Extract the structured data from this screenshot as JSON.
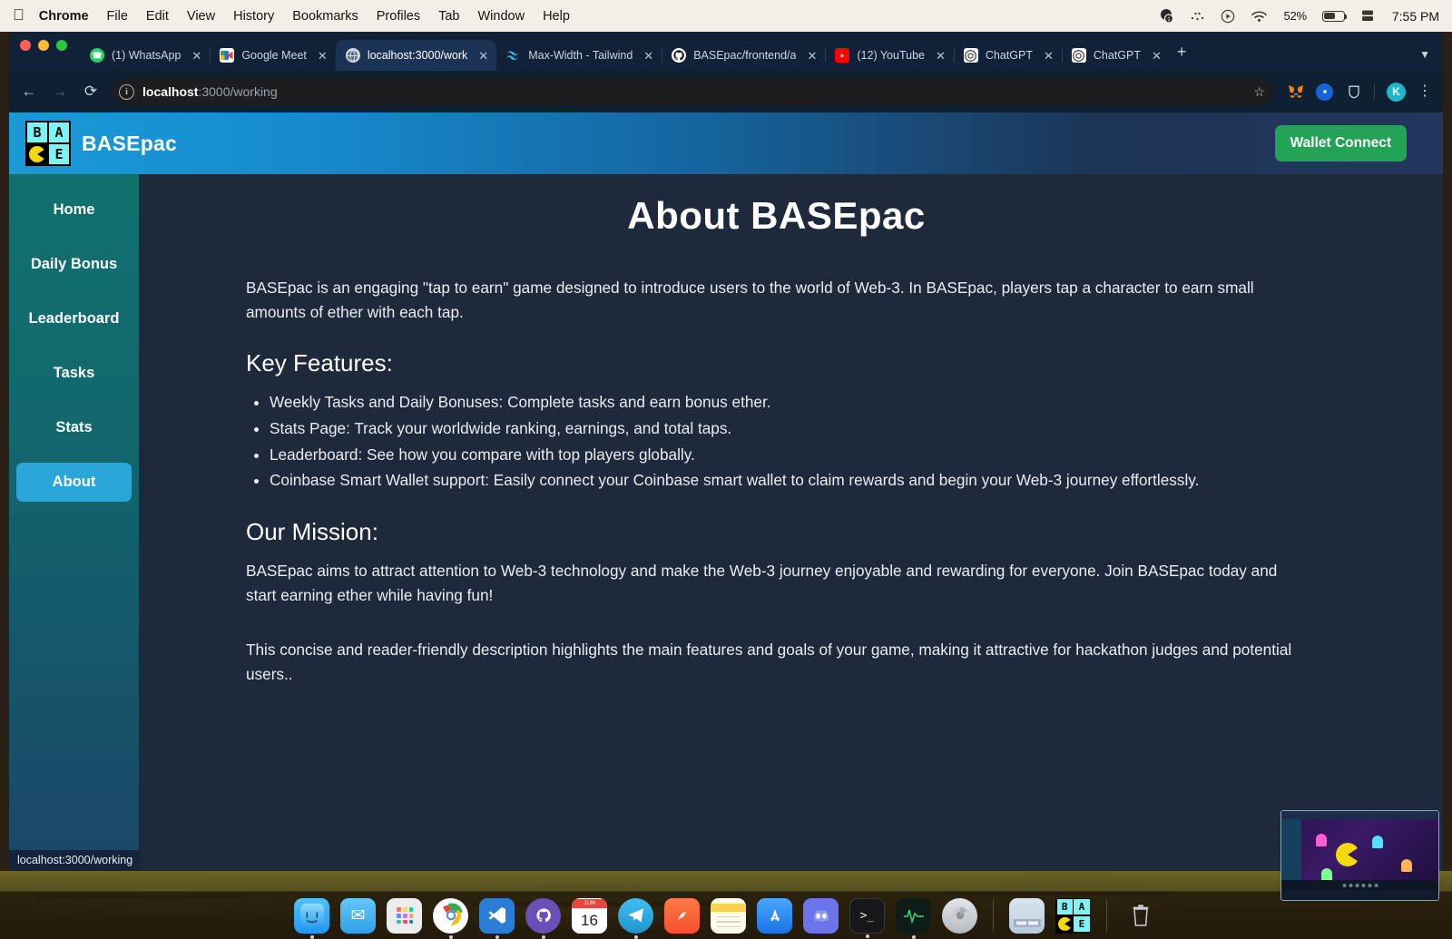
{
  "menubar": {
    "apple_icon": "apple-icon",
    "items": [
      {
        "label": "Chrome",
        "bold": true
      },
      {
        "label": "File",
        "bold": false
      },
      {
        "label": "Edit",
        "bold": false
      },
      {
        "label": "View",
        "bold": false
      },
      {
        "label": "History",
        "bold": false
      },
      {
        "label": "Bookmarks",
        "bold": false
      },
      {
        "label": "Profiles",
        "bold": false
      },
      {
        "label": "Tab",
        "bold": false
      },
      {
        "label": "Window",
        "bold": false
      },
      {
        "label": "Help",
        "bold": false
      }
    ],
    "status": {
      "notification_icon": "notification-badge-icon",
      "bluetooth_icon": "bluetooth-icon",
      "control_center_icon": "control-center-icon",
      "wifi_icon": "wifi-icon",
      "battery_percent": "52%",
      "battery_icon": "battery-icon",
      "display_icon": "display-icon",
      "clock": "7:55 PM"
    }
  },
  "browser": {
    "window_controls": [
      "close",
      "minimize",
      "maximize"
    ],
    "tabs": [
      {
        "title": "(1) WhatsApp",
        "favicon": "whatsapp-icon",
        "active": false
      },
      {
        "title": "Google Meet",
        "favicon": "google-meet-icon",
        "active": false
      },
      {
        "title": "localhost:3000/work",
        "favicon": "globe-icon",
        "active": true
      },
      {
        "title": "Max-Width - Tailwind",
        "favicon": "tailwind-icon",
        "active": false
      },
      {
        "title": "BASEpac/frontend/a",
        "favicon": "github-icon",
        "active": false
      },
      {
        "title": "(12) YouTube",
        "favicon": "youtube-icon",
        "active": false
      },
      {
        "title": "ChatGPT",
        "favicon": "chatgpt-icon",
        "active": false
      },
      {
        "title": "ChatGPT",
        "favicon": "chatgpt-icon",
        "active": false
      }
    ],
    "new_tab_label": "+",
    "tab_search_icon": "chevron-down-icon",
    "back_icon": "back-arrow-icon",
    "forward_icon": "forward-arrow-icon",
    "reload_icon": "reload-icon",
    "url_host": "localhost",
    "url_path": ":3000/working",
    "site_info_icon": "info-circle-icon",
    "bookmark_icon": "star-icon",
    "extensions": [
      "metamask-icon",
      "extension-blue-icon",
      "extension-shield-icon"
    ],
    "profile_initial": "K",
    "menu_icon": "kebab-menu-icon"
  },
  "app": {
    "brand_name": "BASEpac",
    "logo_cells": [
      "B",
      "A",
      "pac-man-icon",
      "E"
    ],
    "wallet_button": "Wallet Connect",
    "accent_green": "#22a355",
    "accent_blue": "#2aa7d8"
  },
  "sidebar": {
    "items": [
      {
        "label": "Home",
        "active": false
      },
      {
        "label": "Daily Bonus",
        "active": false
      },
      {
        "label": "Leaderboard",
        "active": false
      },
      {
        "label": "Tasks",
        "active": false
      },
      {
        "label": "Stats",
        "active": false
      },
      {
        "label": "About",
        "active": true
      }
    ]
  },
  "main": {
    "title": "About BASEpac",
    "intro": "BASEpac is an engaging \"tap to earn\" game designed to introduce users to the world of Web-3. In BASEpac, players tap a character to earn small amounts of ether with each tap.",
    "features_heading": "Key Features:",
    "features": [
      "Weekly Tasks and Daily Bonuses: Complete tasks and earn bonus ether.",
      "Stats Page: Track your worldwide ranking, earnings, and total taps.",
      "Leaderboard: See how you compare with top players globally.",
      "Coinbase Smart Wallet support: Easily connect your Coinbase smart wallet to claim rewards and begin your Web-3 journey effortlessly."
    ],
    "mission_heading": "Our Mission:",
    "mission": "BASEpac aims to attract attention to Web-3 technology and make the Web-3 journey enjoyable and rewarding for everyone. Join BASEpac today and start earning ether while having fun!",
    "closing": "This concise and reader-friendly description highlights the main features and goals of your game, making it attractive for hackathon judges and potential users.."
  },
  "status_bar": {
    "link_preview": "localhost:3000/working"
  },
  "dock": {
    "items": [
      {
        "name": "finder-icon",
        "glyph": "☺",
        "bg": "#3fa9f5",
        "running": true
      },
      {
        "name": "mail-icon",
        "glyph": "✉",
        "bg": "#45b3f0",
        "running": false
      },
      {
        "name": "launchpad-icon",
        "glyph": "",
        "bg": "#e9e9ec",
        "running": false
      },
      {
        "name": "chrome-icon",
        "glyph": "",
        "bg": "#f5f5f5",
        "running": true
      },
      {
        "name": "vscode-icon",
        "glyph": "✕",
        "bg": "#2a7fd4",
        "running": true
      },
      {
        "name": "github-desktop-icon",
        "glyph": "",
        "bg": "#6b4fb8",
        "running": true
      },
      {
        "name": "calendar-icon",
        "glyph": "16",
        "bg": "#ffffff",
        "running": false
      },
      {
        "name": "telegram-icon",
        "glyph": "➤",
        "bg": "#35a5e0",
        "running": true
      },
      {
        "name": "safari-icon",
        "glyph": "╱",
        "bg": "#ff5a3c",
        "running": false
      },
      {
        "name": "notes-icon",
        "glyph": "",
        "bg": "#fdf3c0",
        "running": false
      },
      {
        "name": "app-store-icon",
        "glyph": "A",
        "bg": "#2b8cf0",
        "running": false
      },
      {
        "name": "discord-icon",
        "glyph": "◉",
        "bg": "#6b74e8",
        "running": false
      },
      {
        "name": "terminal-icon",
        "glyph": "❯_",
        "bg": "#1b1b1b",
        "running": true
      },
      {
        "name": "activity-monitor-icon",
        "glyph": "⌇",
        "bg": "#12201a",
        "running": true
      },
      {
        "name": "system-settings-icon",
        "glyph": "⚙",
        "bg": "#c9ccd1",
        "running": false
      },
      {
        "name": "screenshot-preview-icon",
        "glyph": "",
        "bg": "#cfdbe8",
        "running": false
      },
      {
        "name": "basepac-app-icon",
        "glyph": "",
        "bg": "#000000",
        "running": true
      },
      {
        "name": "trash-icon",
        "glyph": "ᴵ",
        "bg": "#9aa3ad",
        "running": false
      }
    ]
  },
  "preview": {
    "name": "screen-share-preview"
  }
}
